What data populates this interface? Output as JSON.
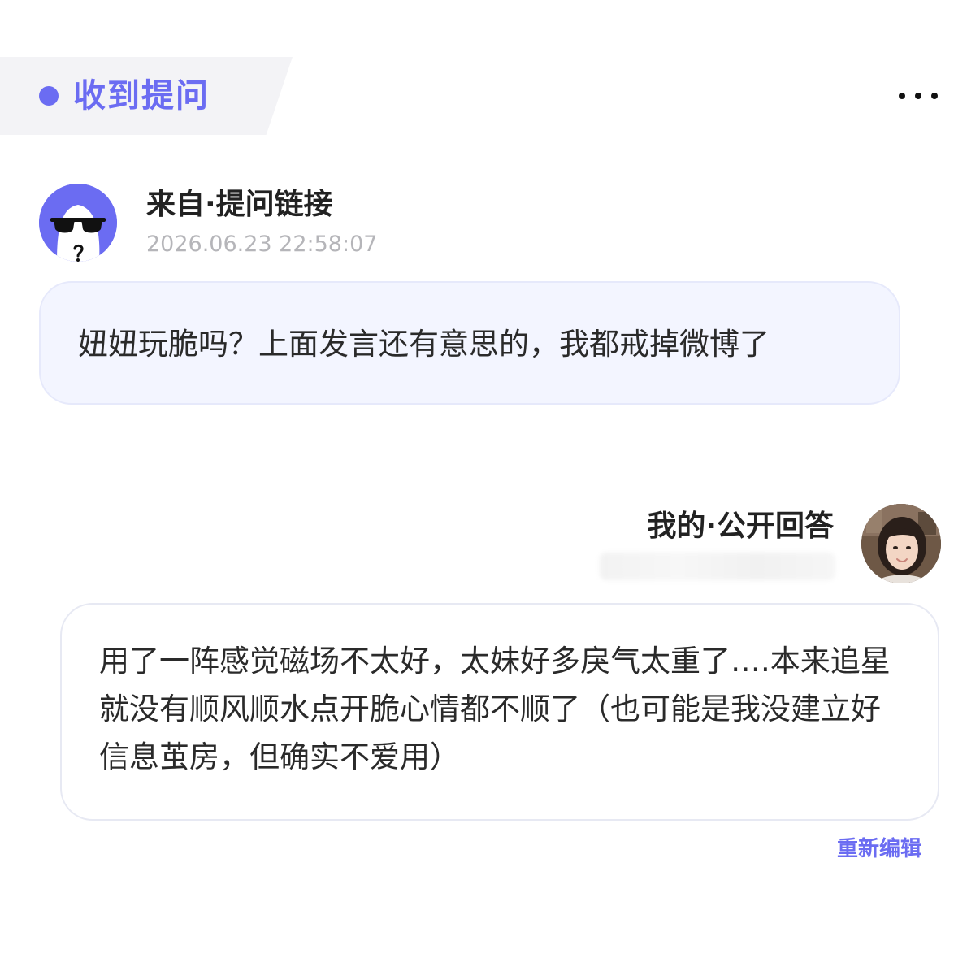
{
  "header": {
    "title": "收到提问",
    "more_icon": "more-horizontal-icon",
    "accent_color": "#6b6cf2"
  },
  "question": {
    "source": "来自·提问链接",
    "timestamp": "2026.06.23 22:58:07",
    "text": "妞妞玩脆吗？上面发言还有意思的，我都戒掉微博了",
    "avatar_icon": "anonymous-sunglasses-avatar"
  },
  "answer": {
    "label": "我的·公开回答",
    "text": "用了一阵感觉磁场不太好，太妹好多戾气太重了….本来追星就没有顺风顺水点开脆心情都不顺了（也可能是我没建立好信息茧房，但确实不爱用）",
    "reedit_label": "重新编辑",
    "avatar_icon": "user-photo-avatar"
  }
}
